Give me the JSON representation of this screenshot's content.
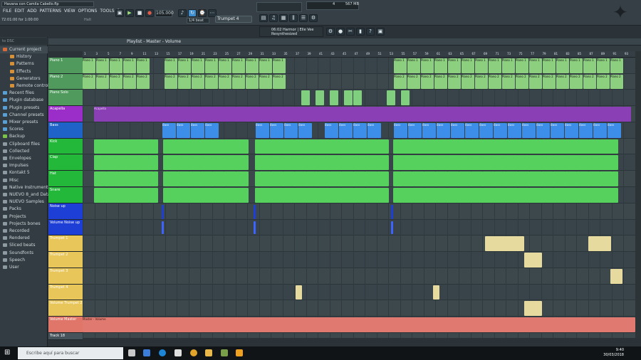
{
  "window": {
    "title": "Havana con Camila Cabello.flp"
  },
  "menu": [
    "FILE",
    "EDIT",
    "ADD",
    "PATTERNS",
    "VIEW",
    "OPTIONS",
    "TOOLS",
    "?"
  ],
  "hint_left": "72:01:00 for 1:00:00",
  "hint_mid": "Halt",
  "tempo": "105.000",
  "snap": "1/4 beat",
  "pattern_selector": "Trumpet 4",
  "cpu": {
    "cpu_value": "4",
    "ram": "567 MB",
    "voices": "0"
  },
  "hint_panel": {
    "line1": "06:02 Harmor | Elle Vee",
    "line2": "Resynthesized"
  },
  "browser": {
    "header": "to DSC",
    "items": [
      {
        "label": "Current project",
        "color": "#d56a3a"
      },
      {
        "label": "History",
        "color": "#d5903a"
      },
      {
        "label": "Patterns",
        "color": "#d5903a"
      },
      {
        "label": "Effects",
        "color": "#d5903a"
      },
      {
        "label": "Generators",
        "color": "#d5903a"
      },
      {
        "label": "Remote control",
        "color": "#d5903a"
      },
      {
        "label": "Recent files",
        "color": "#5a9fd4"
      },
      {
        "label": "Plugin database",
        "color": "#5a9fd4"
      },
      {
        "label": "Plugin presets",
        "color": "#5a9fd4"
      },
      {
        "label": "Channel presets",
        "color": "#5a9fd4"
      },
      {
        "label": "Mixer presets",
        "color": "#5a9fd4"
      },
      {
        "label": "Scores",
        "color": "#5a9fd4"
      },
      {
        "label": "Backup",
        "color": "#7cc24a"
      },
      {
        "label": "Clipboard files",
        "color": "#8e9aa1"
      },
      {
        "label": "Collected",
        "color": "#8e9aa1"
      },
      {
        "label": "Envelopes",
        "color": "#8e9aa1"
      },
      {
        "label": "Impulses",
        "color": "#8e9aa1"
      },
      {
        "label": "Kontakt 5",
        "color": "#8e9aa1"
      },
      {
        "label": "Misc",
        "color": "#8e9aa1"
      },
      {
        "label": "Native Instruments",
        "color": "#8e9aa1"
      },
      {
        "label": "NUEVO 8_and Data",
        "color": "#8e9aa1"
      },
      {
        "label": "NUEVO Samples",
        "color": "#8e9aa1"
      },
      {
        "label": "Packs",
        "color": "#8e9aa1"
      },
      {
        "label": "Projects",
        "color": "#8e9aa1"
      },
      {
        "label": "Projects bones",
        "color": "#8e9aa1"
      },
      {
        "label": "Recorded",
        "color": "#8e9aa1"
      },
      {
        "label": "Rendered",
        "color": "#8e9aa1"
      },
      {
        "label": "Sliced beats",
        "color": "#8e9aa1"
      },
      {
        "label": "Soundfonts",
        "color": "#8e9aa1"
      },
      {
        "label": "Speech",
        "color": "#8e9aa1"
      },
      {
        "label": "User",
        "color": "#8e9aa1"
      }
    ]
  },
  "playlist": {
    "title": "Playlist - Master - Volume",
    "bar_numbers": [
      "1",
      "3",
      "5",
      "7",
      "9",
      "11",
      "13",
      "15",
      "17",
      "19",
      "21",
      "23",
      "25",
      "27",
      "29",
      "31",
      "33",
      "35",
      "37",
      "39",
      "41",
      "43",
      "45",
      "47",
      "49",
      "51",
      "53",
      "55",
      "57",
      "59",
      "61",
      "63",
      "65",
      "67",
      "69",
      "71",
      "73",
      "75",
      "77",
      "79",
      "81",
      "83",
      "85",
      "87",
      "89",
      "91",
      "93"
    ],
    "tracks": [
      {
        "label": "Piano 1",
        "color": "#4f9a5c",
        "h": 23
      },
      {
        "label": "Piano 2",
        "color": "#4f9a5c",
        "h": 22
      },
      {
        "label": "Piano Solo",
        "color": "#4f9a5c",
        "h": 23
      },
      {
        "label": "Acapella",
        "color": "#9b2ec9",
        "h": 23
      },
      {
        "label": "Bass",
        "color": "#1f63c8",
        "h": 23
      },
      {
        "label": "Kick",
        "color": "#24b83a",
        "h": 22
      },
      {
        "label": "Clap",
        "color": "#24b83a",
        "h": 23
      },
      {
        "label": "Hat",
        "color": "#24b83a",
        "h": 23
      },
      {
        "label": "Snare",
        "color": "#24b83a",
        "h": 23
      },
      {
        "label": "Noise up",
        "color": "#1e3fd6",
        "h": 23
      },
      {
        "label": "Volume Noise up",
        "color": "#1e3fd6",
        "h": 22
      },
      {
        "label": "Trumpet 1",
        "color": "#e8c65a",
        "h": 23
      },
      {
        "label": "Trumpet 2",
        "color": "#e8c65a",
        "h": 23
      },
      {
        "label": "Trumpet 3",
        "color": "#e8c65a",
        "h": 23
      },
      {
        "label": "Trumpet 4",
        "color": "#e8c65a",
        "h": 22
      },
      {
        "label": "Volume Trumpet 2",
        "color": "#e8c65a",
        "h": 23
      },
      {
        "label": "Volume Master",
        "color": "#e0766a",
        "h": 23
      },
      {
        "label": "Track 18",
        "color": "#47535a",
        "h": 10
      }
    ],
    "clip_labels": {
      "piano1": "Piano 1",
      "piano2": "Piano 2",
      "acapella": "Acapella",
      "bass": "Bass",
      "master": "Master - Volume"
    }
  },
  "taskbar": {
    "search_placeholder": "Escribe aquí para buscar",
    "time": "9:40",
    "date": "30/03/2018"
  }
}
